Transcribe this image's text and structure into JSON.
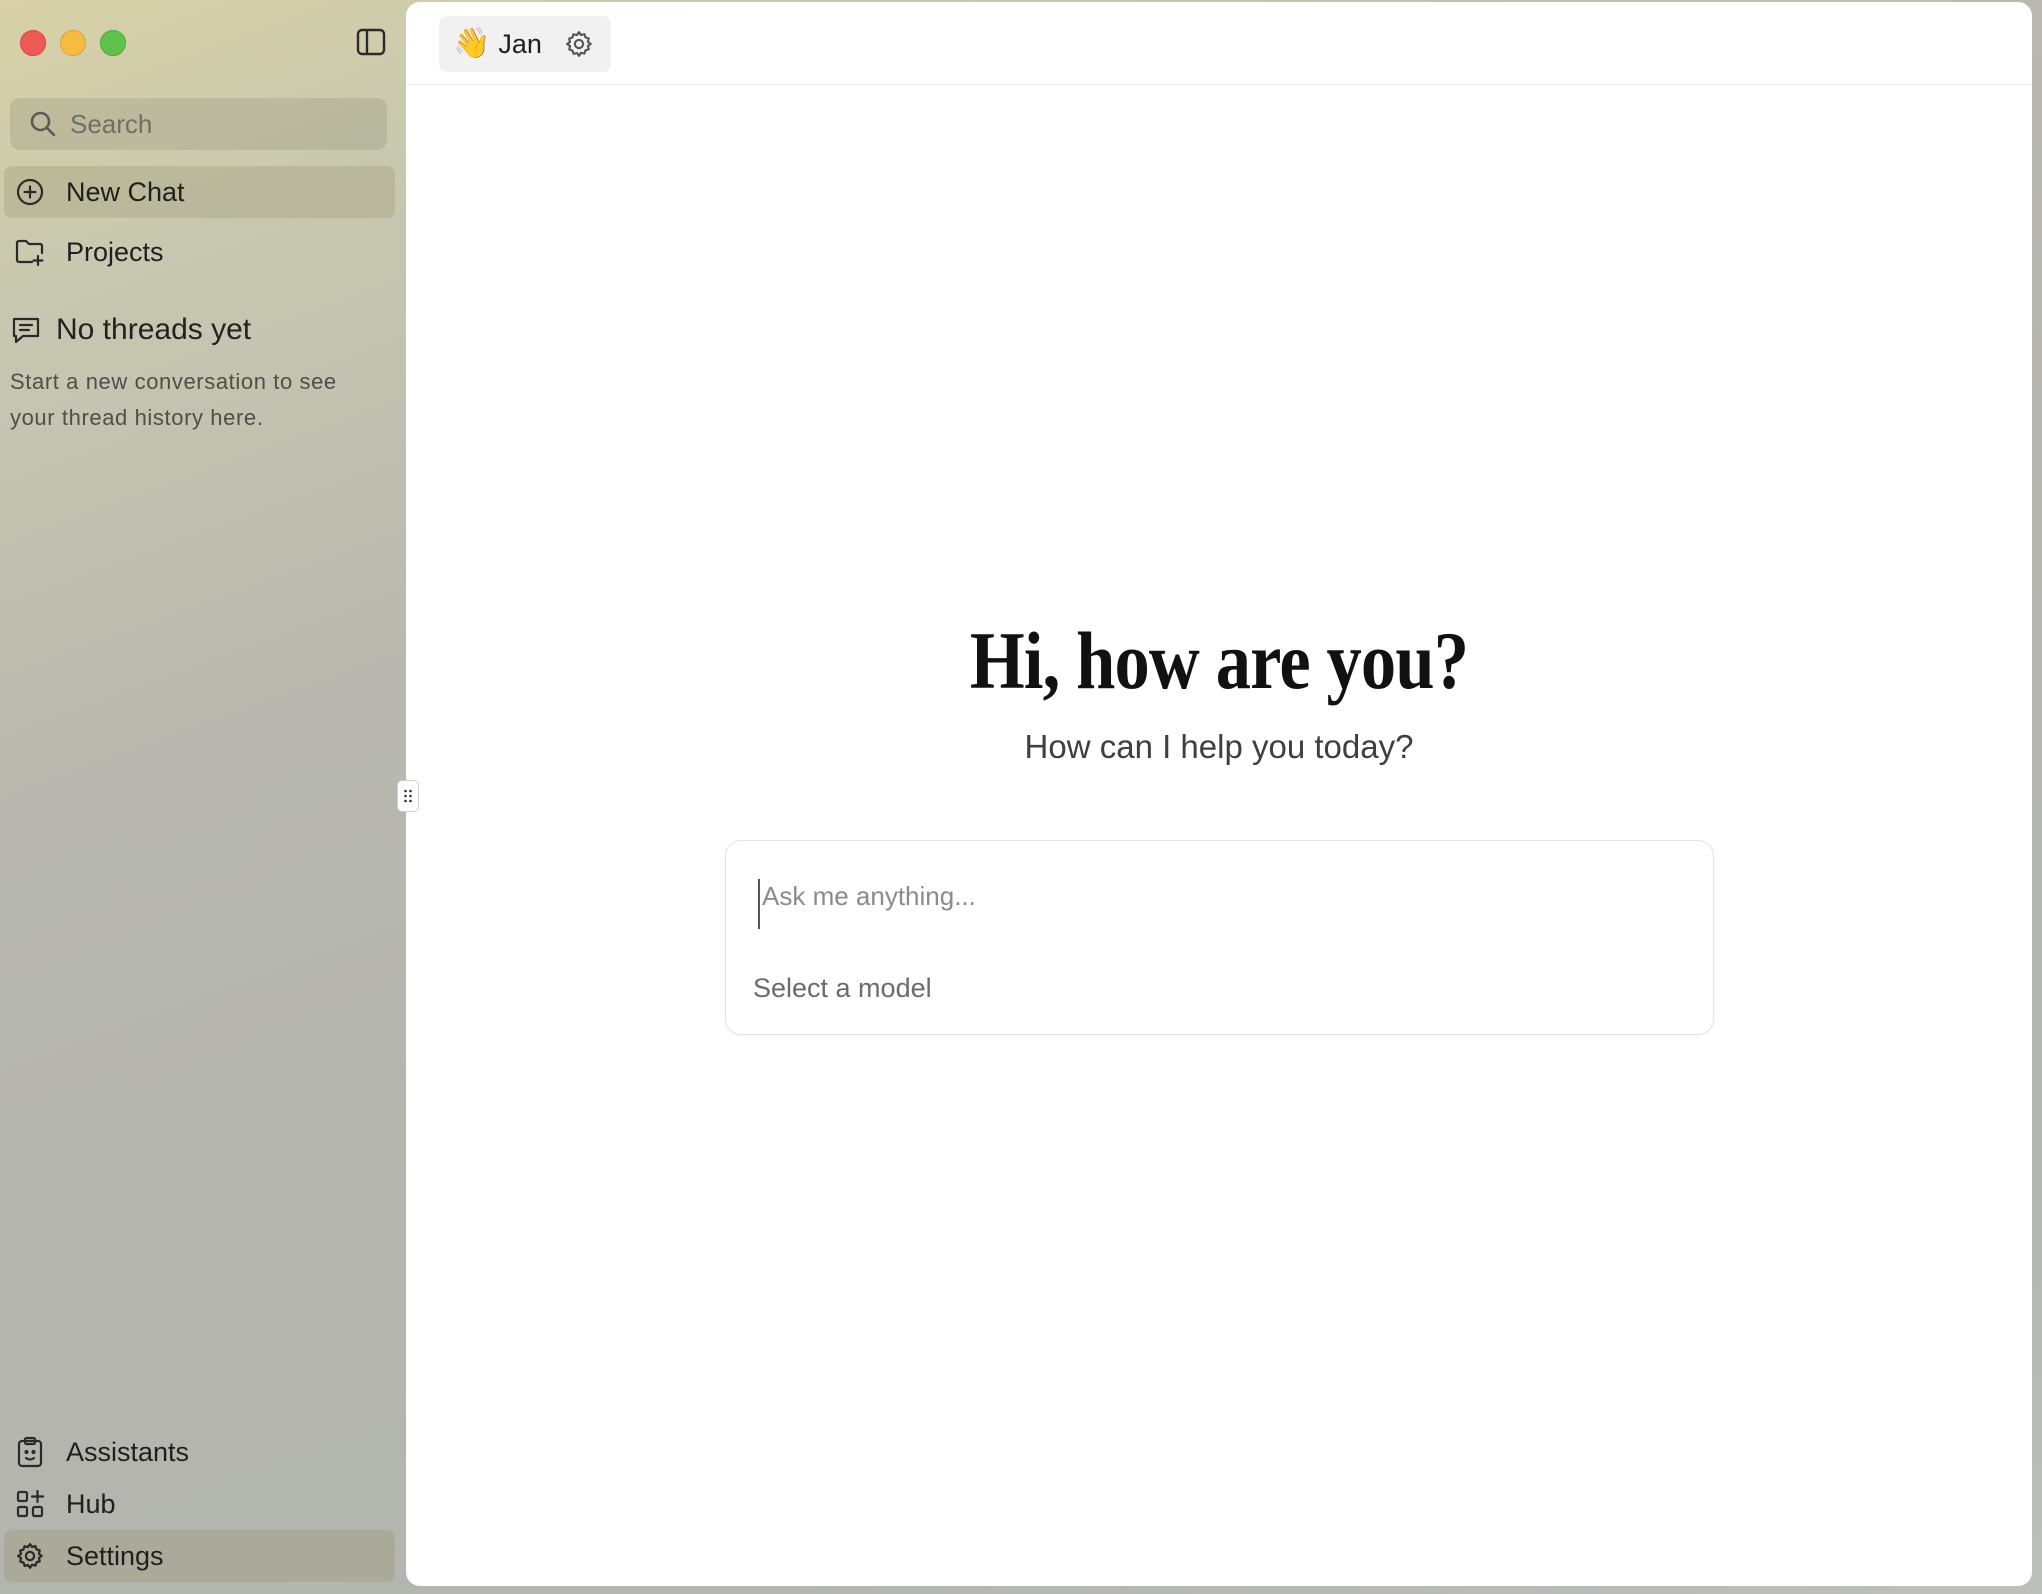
{
  "sidebar": {
    "search_placeholder": "Search",
    "new_chat": "New Chat",
    "projects": "Projects",
    "empty_title": "No threads yet",
    "empty_description": "Start a new conversation to see your thread history here.",
    "assistants": "Assistants",
    "hub": "Hub",
    "settings": "Settings"
  },
  "header": {
    "assistant_emoji": "👋",
    "assistant_name": "Jan"
  },
  "main": {
    "greeting": "Hi, how are you?",
    "subgreeting": "How can I help you today?",
    "input_placeholder": "Ask me anything...",
    "model_selector": "Select a model"
  },
  "icons": {
    "search": "search-icon",
    "new_chat": "plus-circle-icon",
    "projects": "folder-plus-icon",
    "threads": "message-square-icon",
    "assistants": "clipboard-icon",
    "hub": "grid-icon",
    "settings": "gear-icon",
    "sidebar_toggle": "sidebar-toggle-icon"
  },
  "colors": {
    "close": "#ee5b55",
    "minimize": "#f5bd3f",
    "zoom": "#5fc24c"
  }
}
